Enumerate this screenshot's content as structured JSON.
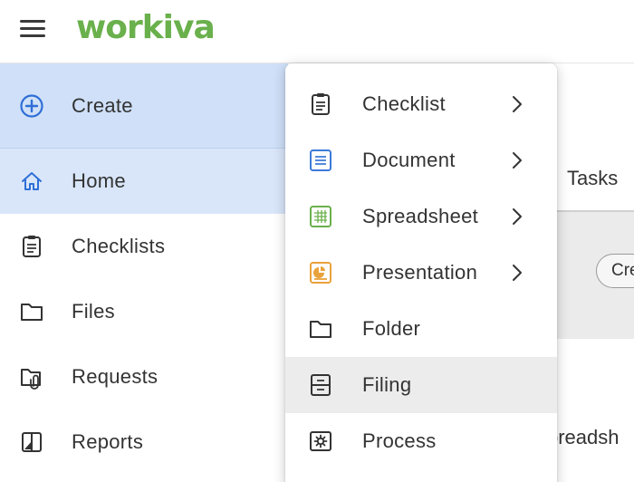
{
  "header": {
    "logo_text": "workiva",
    "brand_color": "#6ab04c"
  },
  "sidebar": {
    "items": [
      {
        "label": "Create",
        "icon": "plus-circle-icon"
      },
      {
        "label": "Home",
        "icon": "home-icon"
      },
      {
        "label": "Checklists",
        "icon": "checklist-icon"
      },
      {
        "label": "Files",
        "icon": "folder-icon"
      },
      {
        "label": "Requests",
        "icon": "request-attachment-icon"
      },
      {
        "label": "Reports",
        "icon": "report-icon"
      }
    ],
    "active_color": "#cfe0f8"
  },
  "background": {
    "tasks_tab": "Tasks",
    "pill_text": "Cre",
    "partial_text": "preadsh"
  },
  "create_menu": {
    "items": [
      {
        "label": "Checklist",
        "icon": "checklist-icon",
        "submenu": true
      },
      {
        "label": "Document",
        "icon": "document-icon",
        "submenu": true
      },
      {
        "label": "Spreadsheet",
        "icon": "spreadsheet-icon",
        "submenu": true
      },
      {
        "label": "Presentation",
        "icon": "presentation-icon",
        "submenu": true
      },
      {
        "label": "Folder",
        "icon": "folder-icon",
        "submenu": false
      },
      {
        "label": "Filing",
        "icon": "filing-icon",
        "submenu": false,
        "highlighted": true
      },
      {
        "label": "Process",
        "icon": "process-gear-icon",
        "submenu": false
      }
    ]
  }
}
